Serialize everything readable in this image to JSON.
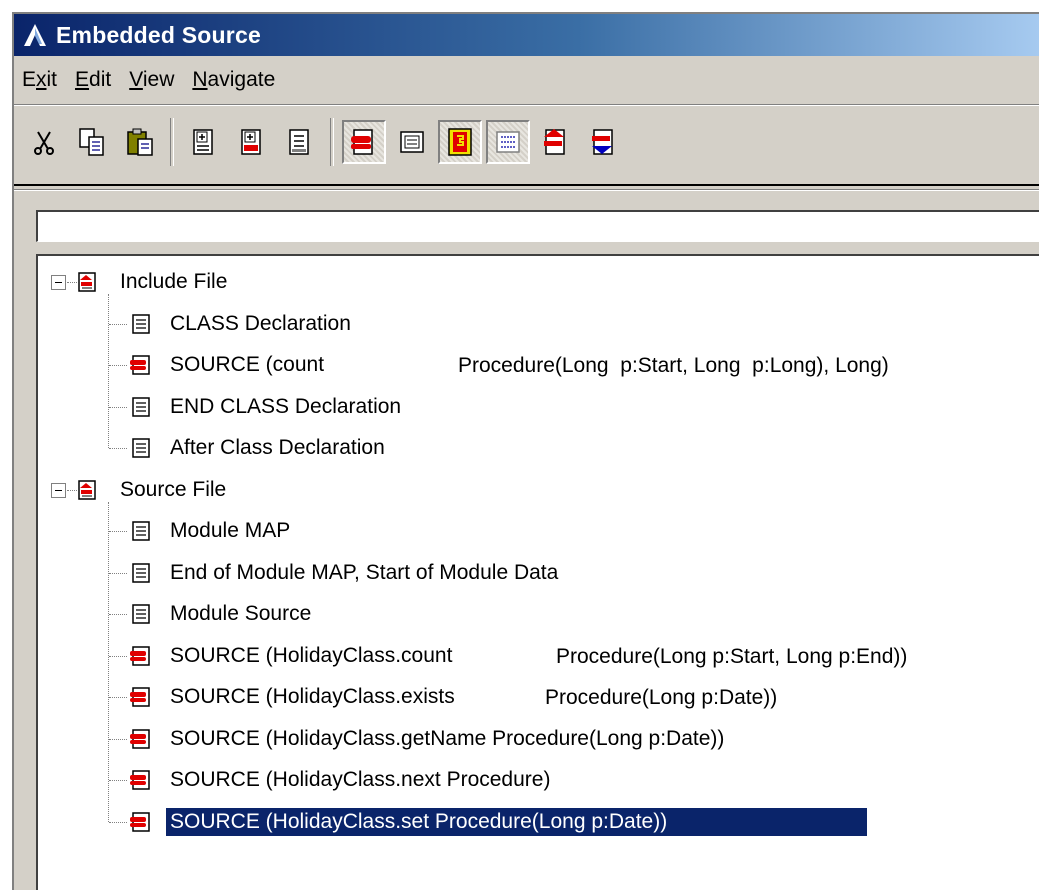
{
  "window": {
    "title": "Embedded Source",
    "colors": {
      "titlebar": "#0a246a",
      "selection": "#0a246a",
      "face": "#d4d0c8"
    }
  },
  "menu": [
    {
      "label": "Exit",
      "mnemonic_index": 1
    },
    {
      "label": "Edit",
      "mnemonic_index": 0
    },
    {
      "label": "View",
      "mnemonic_index": 0
    },
    {
      "label": "Navigate",
      "mnemonic_index": 0
    }
  ],
  "toolbar": [
    {
      "icon": "scissors-icon",
      "action": "cut"
    },
    {
      "icon": "copy-icon",
      "action": "copy"
    },
    {
      "icon": "paste-icon",
      "action": "paste"
    },
    {
      "separator": true
    },
    {
      "icon": "expand-icon",
      "action": "expand"
    },
    {
      "icon": "expand-red-icon",
      "action": "expand-filled"
    },
    {
      "icon": "collapse-icon",
      "action": "collapse"
    },
    {
      "separator": true
    },
    {
      "icon": "filled-embed-icon",
      "action": "filled",
      "pressed": true
    },
    {
      "icon": "all-embeds-icon",
      "action": "all"
    },
    {
      "icon": "priority-icon",
      "action": "priority",
      "pressed": true
    },
    {
      "icon": "contract-icon",
      "action": "contract",
      "pressed": true
    },
    {
      "icon": "prev-filled-icon",
      "action": "prev"
    },
    {
      "icon": "next-filled-icon",
      "action": "next"
    }
  ],
  "search": {
    "value": "",
    "placeholder": ""
  },
  "tree": {
    "groups": [
      {
        "label": "Include File",
        "expanded": true,
        "children": [
          {
            "label": "CLASS Declaration",
            "type": "empty"
          },
          {
            "label": "SOURCE (count",
            "detail": "Procedure(Long  p:Start, Long  p:Long), Long)",
            "type": "filled"
          },
          {
            "label": "END CLASS Declaration",
            "type": "empty"
          },
          {
            "label": "After Class Declaration",
            "type": "empty"
          }
        ]
      },
      {
        "label": "Source File",
        "expanded": true,
        "children": [
          {
            "label": "Module MAP",
            "type": "empty"
          },
          {
            "label": "End of Module MAP, Start of Module Data",
            "type": "empty"
          },
          {
            "label": "Module Source",
            "type": "empty"
          },
          {
            "label": "SOURCE (HolidayClass.count",
            "detail": "Procedure(Long p:Start, Long p:End))",
            "type": "filled"
          },
          {
            "label": "SOURCE (HolidayClass.exists",
            "detail": "Procedure(Long p:Date))",
            "type": "filled"
          },
          {
            "label": "SOURCE (HolidayClass.getName Procedure(Long p:Date))",
            "type": "filled"
          },
          {
            "label": "SOURCE (HolidayClass.next Procedure)",
            "type": "filled"
          },
          {
            "label": "SOURCE (HolidayClass.set Procedure(Long p:Date))",
            "type": "filled",
            "selected": true
          }
        ]
      }
    ]
  }
}
